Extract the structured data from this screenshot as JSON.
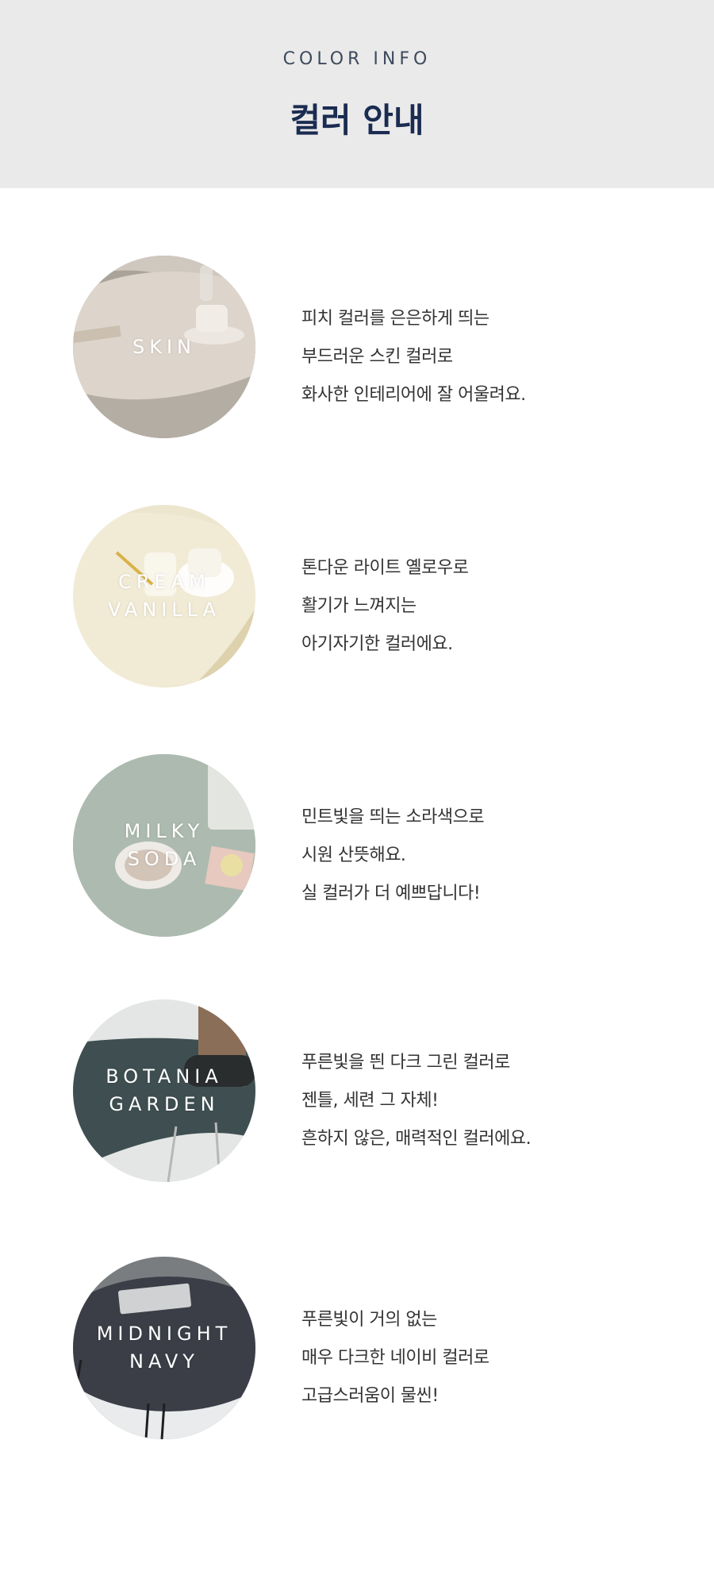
{
  "header": {
    "subtitle": "COLOR INFO",
    "title": "컬러 안내"
  },
  "colors": [
    {
      "label_lines": [
        "SKIN",
        ""
      ],
      "description": [
        "피치 컬러를 은은하게 띄는",
        "부드러운 스킨 컬러로",
        "화사한 인테리어에 잘 어울려요."
      ]
    },
    {
      "label_lines": [
        "CREAM",
        "VANILLA"
      ],
      "description": [
        "톤다운 라이트 옐로우로",
        "활기가 느껴지는",
        "아기자기한 컬러에요."
      ]
    },
    {
      "label_lines": [
        "MILKY",
        "SODA"
      ],
      "description": [
        "민트빛을 띄는 소라색으로",
        "시원 산뜻해요.",
        "실 컬러가 더 예쁘답니다!"
      ]
    },
    {
      "label_lines": [
        "BOTANIA",
        "GARDEN"
      ],
      "description": [
        "푸른빛을 띈 다크 그린 컬러로",
        "젠틀, 세련 그 자체!",
        "흔하지 않은, 매력적인 컬러에요."
      ]
    },
    {
      "label_lines": [
        "MIDNIGHT",
        "NAVY"
      ],
      "description": [
        "푸른빛이 거의 없는",
        "매우 다크한 네이비 컬러로",
        "고급스러움이 물씬!"
      ]
    }
  ]
}
